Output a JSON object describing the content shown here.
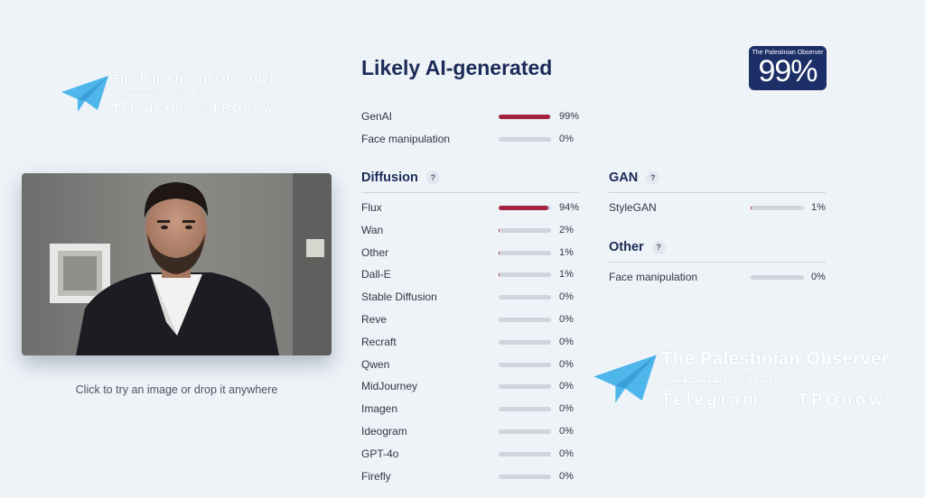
{
  "watermark": {
    "name_en": "The Palestinian Observer",
    "name_ar": "المراقب الفلسطيني",
    "telegram": "Telegram: @TPOnow"
  },
  "upload": {
    "hint": "Click to try an image or drop it anywhere"
  },
  "verdict": {
    "title": "Likely AI-generated",
    "badge_label": "The Palestinian Observer",
    "badge_value": "99%"
  },
  "summary": [
    {
      "label": "GenAI",
      "percent": "99%",
      "value": 0.99
    },
    {
      "label": "Face manipulation",
      "percent": "0%",
      "value": 0
    }
  ],
  "diffusion": {
    "title": "Diffusion",
    "help": "?",
    "items": [
      {
        "label": "Flux",
        "percent": "94%",
        "value": 0.94
      },
      {
        "label": "Wan",
        "percent": "2%",
        "value": 0.02
      },
      {
        "label": "Other",
        "percent": "1%",
        "value": 0.01
      },
      {
        "label": "Dall-E",
        "percent": "1%",
        "value": 0.01
      },
      {
        "label": "Stable Diffusion",
        "percent": "0%",
        "value": 0
      },
      {
        "label": "Reve",
        "percent": "0%",
        "value": 0
      },
      {
        "label": "Recraft",
        "percent": "0%",
        "value": 0
      },
      {
        "label": "Qwen",
        "percent": "0%",
        "value": 0
      },
      {
        "label": "MidJourney",
        "percent": "0%",
        "value": 0
      },
      {
        "label": "Imagen",
        "percent": "0%",
        "value": 0
      },
      {
        "label": "Ideogram",
        "percent": "0%",
        "value": 0
      },
      {
        "label": "GPT-4o",
        "percent": "0%",
        "value": 0
      },
      {
        "label": "Firefly",
        "percent": "0%",
        "value": 0
      }
    ]
  },
  "gan": {
    "title": "GAN",
    "help": "?",
    "items": [
      {
        "label": "StyleGAN",
        "percent": "1%",
        "value": 0.01
      }
    ]
  },
  "other": {
    "title": "Other",
    "help": "?",
    "items": [
      {
        "label": "Face manipulation",
        "percent": "0%",
        "value": 0
      }
    ]
  },
  "colors": {
    "bar_fill": "#a4223f",
    "bar_track": "#cfd5de",
    "heading": "#1b2a57",
    "badge_bg": "#1c2f67",
    "watermark_plane": "#4fb6ec"
  }
}
